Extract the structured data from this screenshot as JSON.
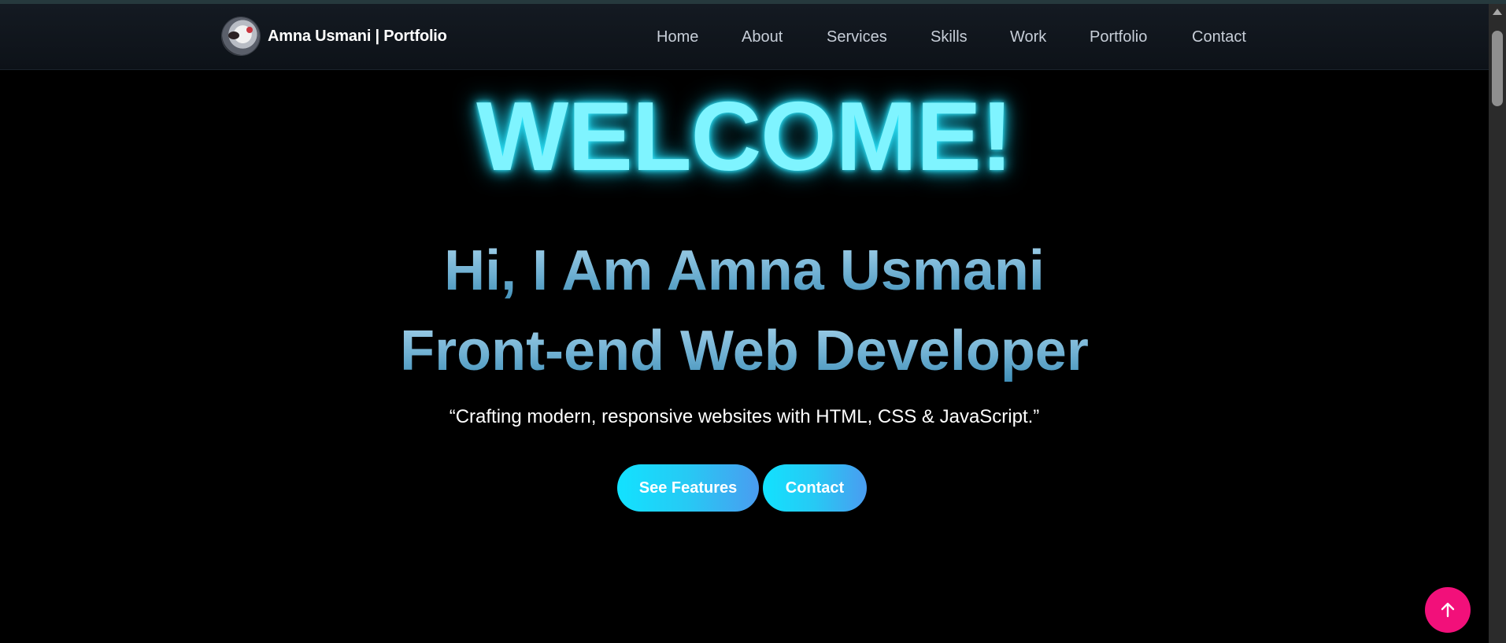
{
  "brand": {
    "name": "Amna Usmani | Portfolio"
  },
  "nav": {
    "items": [
      {
        "label": "Home"
      },
      {
        "label": "About"
      },
      {
        "label": "Services"
      },
      {
        "label": "Skills"
      },
      {
        "label": "Work"
      },
      {
        "label": "Portfolio"
      },
      {
        "label": "Contact"
      }
    ]
  },
  "hero": {
    "welcome": "WELCOME!",
    "headline_line1": "Hi, I Am Amna Usmani",
    "headline_line2": "Front-end Web Developer",
    "tagline": "“Crafting modern, responsive websites with HTML, CSS & JavaScript.”",
    "buttons": {
      "features": "See Features",
      "contact": "Contact"
    }
  },
  "icons": {
    "back_to_top": "arrow-up-icon",
    "avatar": "profile-photo"
  },
  "colors": {
    "background": "#000000",
    "navbar": "#10161d",
    "welcome_glow": "#7ff4ff",
    "headline": "#7bb8d8",
    "button_gradient_start": "#12e2ff",
    "button_gradient_end": "#4a9cf0",
    "back_to_top": "#f2107a"
  }
}
